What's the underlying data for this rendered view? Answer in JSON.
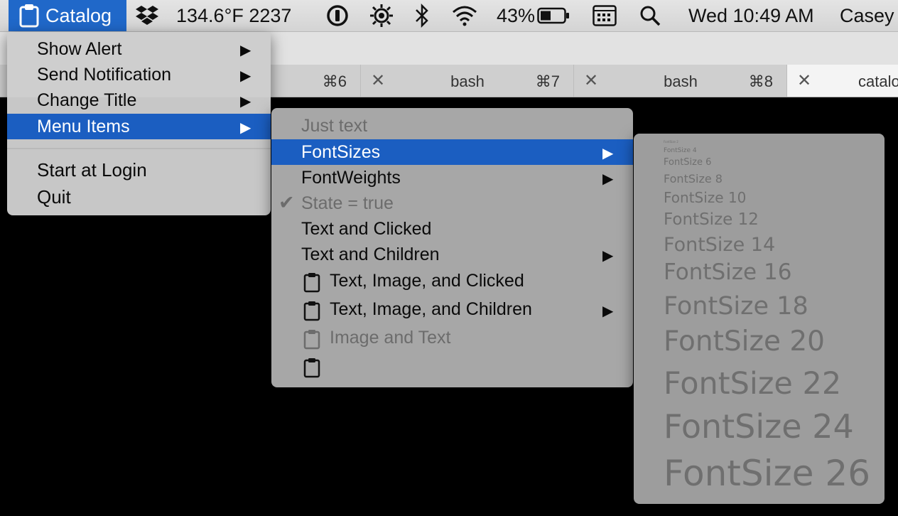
{
  "menubar": {
    "app_name": "Catalog",
    "temperature": "134.6°F 2237",
    "battery_percent": "43%",
    "clock": "Wed 10:49 AM",
    "user": "Casey"
  },
  "tabs": [
    {
      "shortcut": "⌘6"
    },
    {
      "label": "bash",
      "shortcut": "⌘7"
    },
    {
      "label": "bash",
      "shortcut": "⌘8"
    },
    {
      "label": "catalo"
    }
  ],
  "menu_main": {
    "items": [
      {
        "label": "Show Alert"
      },
      {
        "label": "Send Notification"
      },
      {
        "label": "Change Title"
      },
      {
        "label": "Menu Items"
      },
      {
        "label": "Start at Login"
      },
      {
        "label": "Quit"
      }
    ]
  },
  "menu_items": {
    "items": [
      {
        "label": "Just text"
      },
      {
        "label": "FontSizes"
      },
      {
        "label": "FontWeights"
      },
      {
        "label": "State = true"
      },
      {
        "label": "Text and Clicked"
      },
      {
        "label": "Text and Children"
      },
      {
        "label": "Text, Image, and Clicked"
      },
      {
        "label": "Text, Image, and Children"
      },
      {
        "label": "Image and Text"
      }
    ]
  },
  "font_sizes": {
    "items": [
      {
        "label": "FontSize 2"
      },
      {
        "label": "FontSize 4"
      },
      {
        "label": "FontSize 6"
      },
      {
        "label": "FontSize 8"
      },
      {
        "label": "FontSize 10"
      },
      {
        "label": "FontSize 12"
      },
      {
        "label": "FontSize 14"
      },
      {
        "label": "FontSize 16"
      },
      {
        "label": "FontSize 18"
      },
      {
        "label": "FontSize 20"
      },
      {
        "label": "FontSize 22"
      },
      {
        "label": "FontSize 24"
      },
      {
        "label": "FontSize 26"
      }
    ]
  }
}
